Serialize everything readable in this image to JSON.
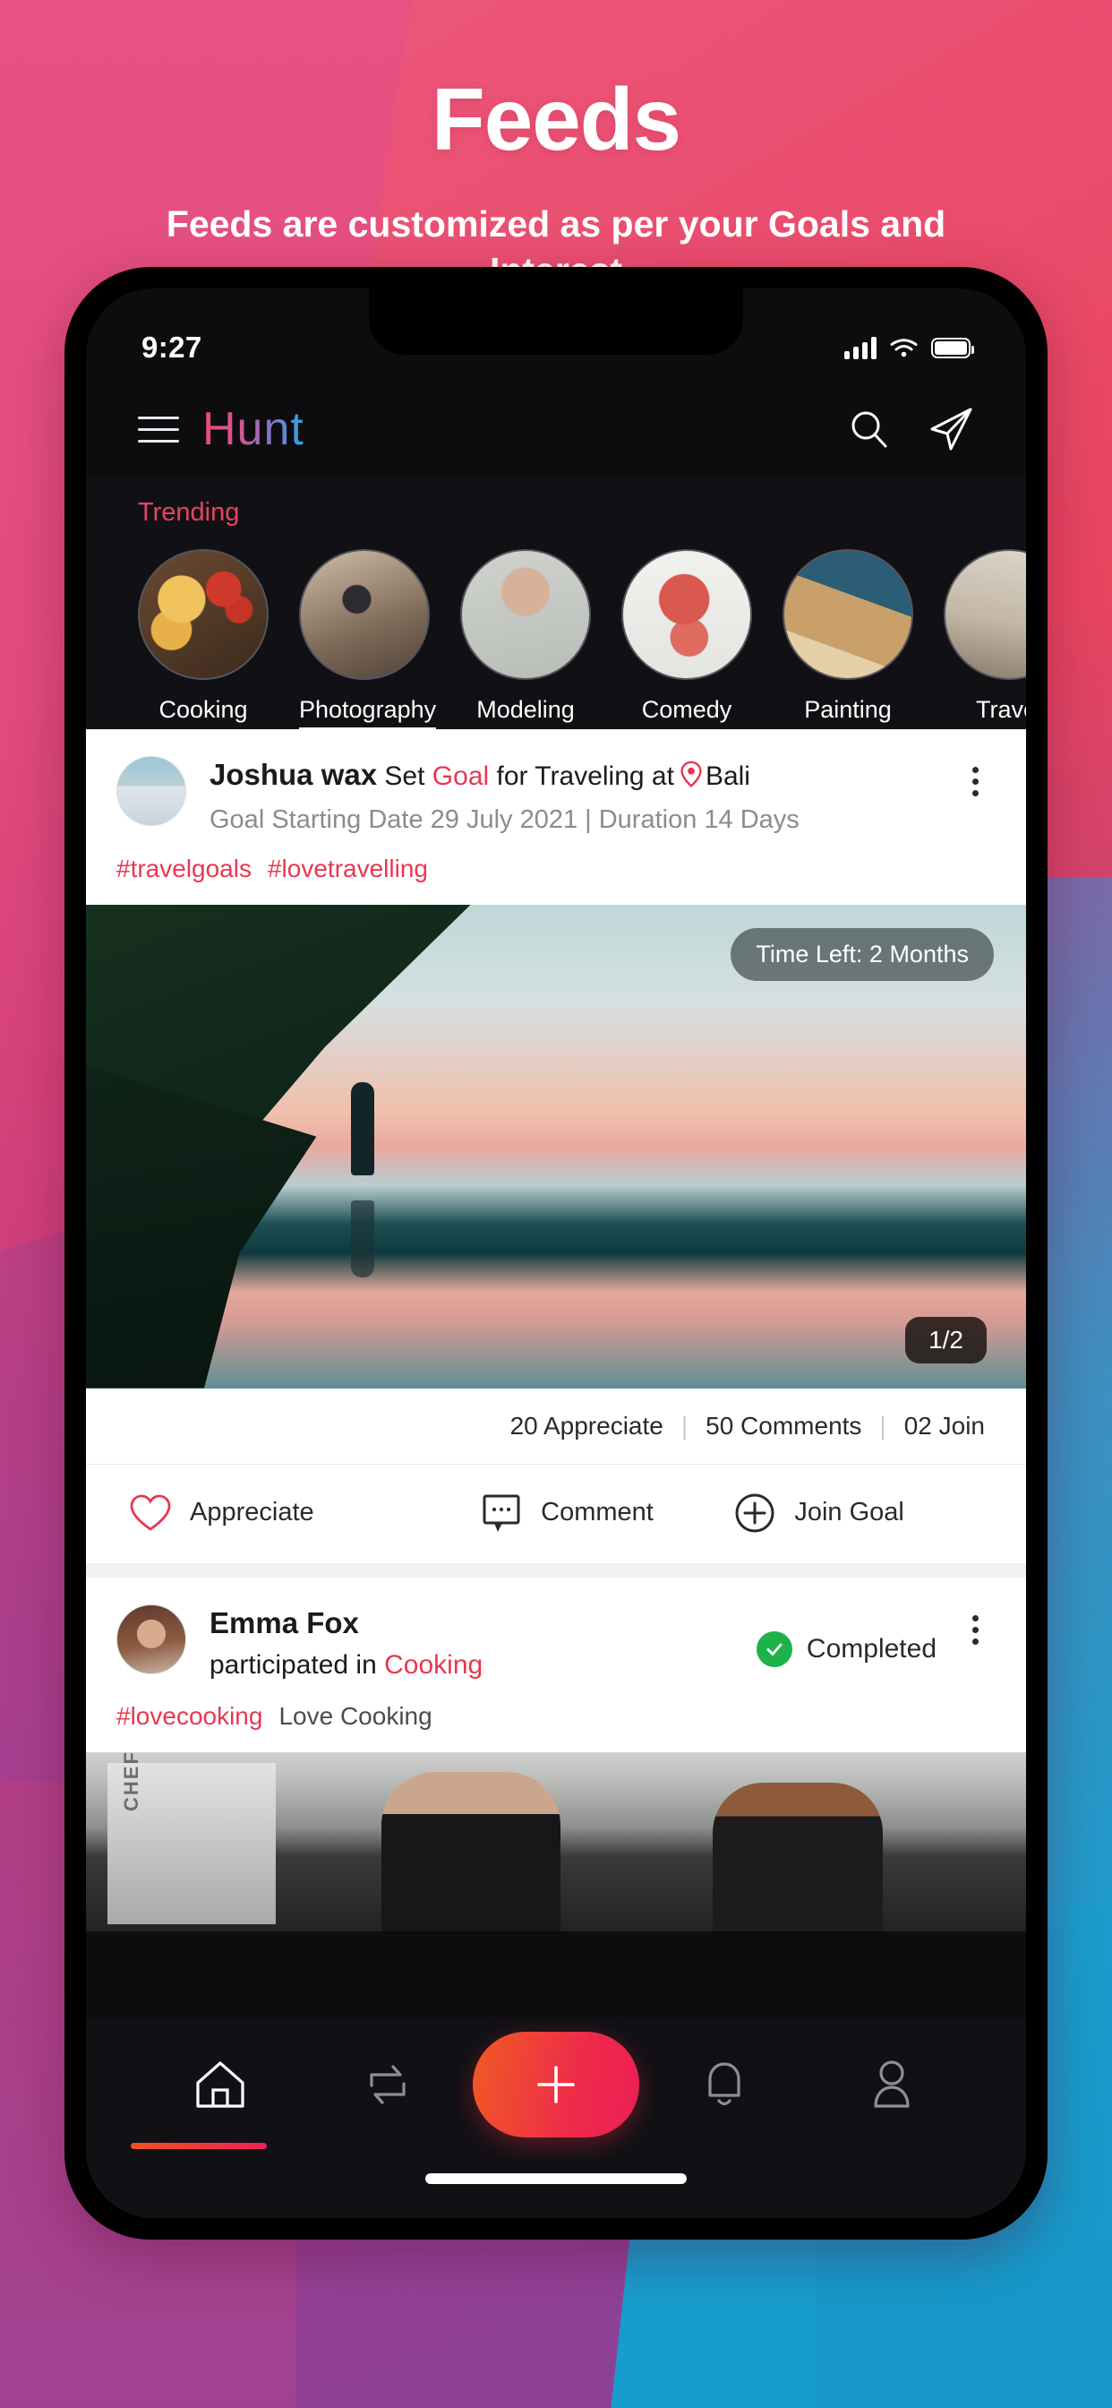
{
  "promo": {
    "title": "Feeds",
    "subtitle": "Feeds are customized as per your Goals and Interest"
  },
  "theme": {
    "accent_red": "#e8384f",
    "accent_pink": "#ef4a6e",
    "brand_blue": "#27a8e0",
    "bg_dark": "#0d0d10",
    "success_green": "#20b24a"
  },
  "status_bar": {
    "time": "9:27",
    "signal_icon": "signal-bars-icon",
    "wifi_icon": "wifi-icon",
    "battery_icon": "battery-icon"
  },
  "app_bar": {
    "menu_icon": "hamburger-menu-icon",
    "brand": "Hunt",
    "search_icon": "search-icon",
    "send_icon": "send-message-icon"
  },
  "trending": {
    "title": "Trending",
    "categories": [
      {
        "label": "Cooking",
        "active": false,
        "thumb": "ph-cooking"
      },
      {
        "label": "Photography",
        "active": true,
        "thumb": "ph-photography"
      },
      {
        "label": "Modeling",
        "active": false,
        "thumb": "ph-modeling"
      },
      {
        "label": "Comedy",
        "active": false,
        "thumb": "ph-comedy"
      },
      {
        "label": "Painting",
        "active": false,
        "thumb": "ph-painting"
      },
      {
        "label": "Travel",
        "active": false,
        "thumb": "ph-travel"
      }
    ]
  },
  "posts": [
    {
      "author": "Joshua wax",
      "action_pre": "Set ",
      "action_highlight": "Goal",
      "action_post": " for Traveling at",
      "location_icon": "location-pin-icon",
      "location": "Bali",
      "meta": "Goal Starting Date 29 July 2021 |  Duration 14 Days",
      "tags": [
        "#travelgoals",
        "#lovetravelling"
      ],
      "more_icon": "more-options-icon",
      "media": {
        "time_left_badge": "Time Left: 2 Months",
        "carousel_counter": "1/2"
      },
      "stats": {
        "appreciate": "20 Appreciate",
        "comments": "50 Comments",
        "join": "02 Join",
        "separator": "|"
      },
      "actions": [
        {
          "label": "Appreciate",
          "icon": "heart-icon"
        },
        {
          "label": "Comment",
          "icon": "comment-bubble-icon"
        },
        {
          "label": "Join Goal",
          "icon": "plus-circle-icon"
        }
      ]
    },
    {
      "author": "Emma Fox",
      "action_pre": "participated in ",
      "action_highlight": "Cooking",
      "status_label": "Completed",
      "status_icon": "check-circle-icon",
      "more_icon": "more-options-icon",
      "tag": "#lovecooking",
      "caption": "Love Cooking"
    }
  ],
  "bottom_nav": {
    "items": [
      {
        "name": "home",
        "icon": "home-icon",
        "active": true
      },
      {
        "name": "exchange",
        "icon": "repeat-swap-icon",
        "active": false
      },
      {
        "name": "create",
        "icon": "plus-icon",
        "active": false
      },
      {
        "name": "notifications",
        "icon": "bell-icon",
        "active": false
      },
      {
        "name": "profile",
        "icon": "person-icon",
        "active": false
      }
    ]
  }
}
